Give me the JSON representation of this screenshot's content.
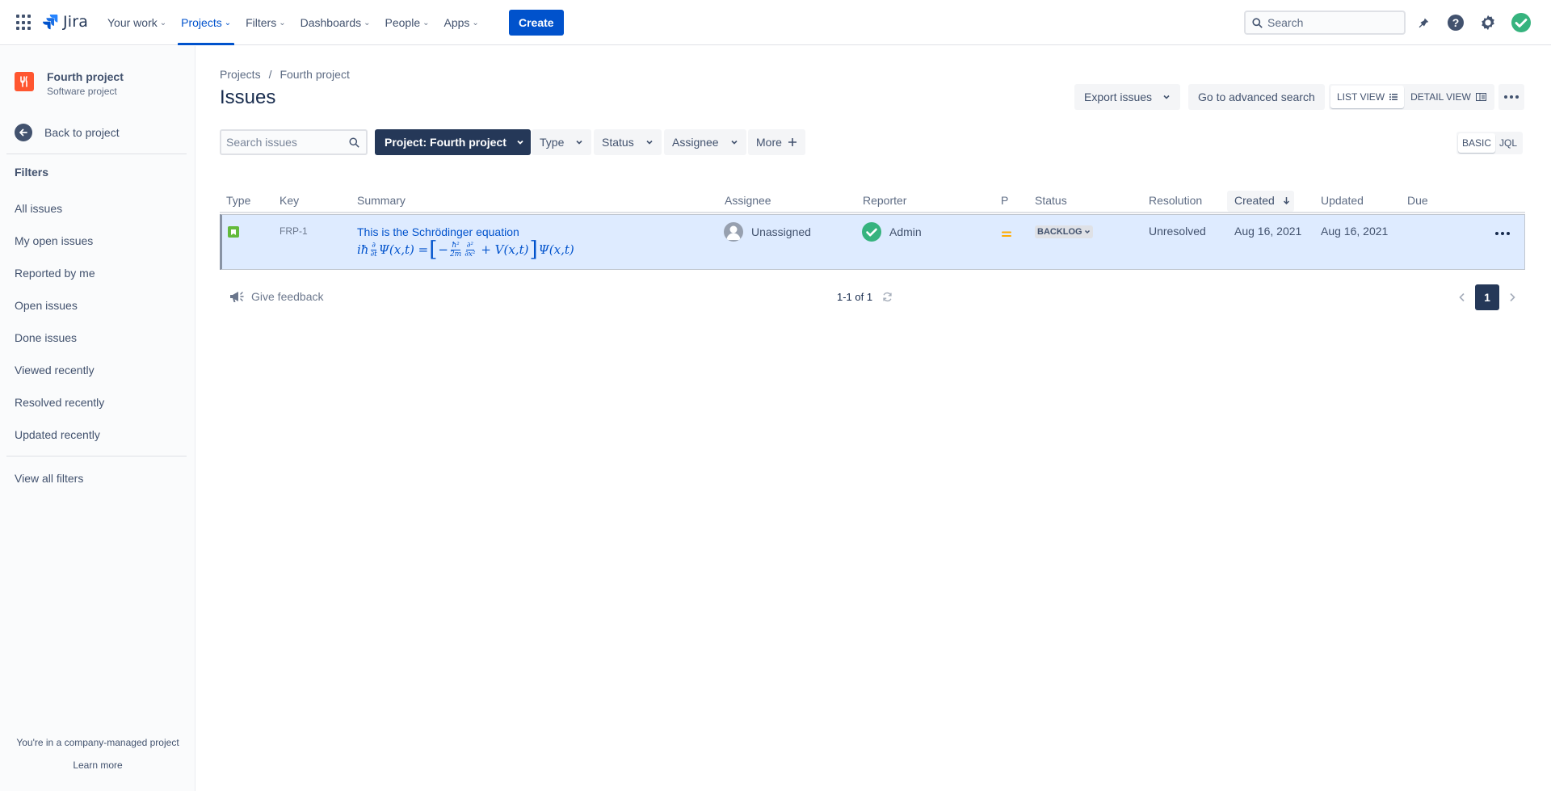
{
  "topnav": {
    "logo_text": "Jira",
    "items": [
      {
        "label": "Your work",
        "active": false
      },
      {
        "label": "Projects",
        "active": true
      },
      {
        "label": "Filters",
        "active": false
      },
      {
        "label": "Dashboards",
        "active": false
      },
      {
        "label": "People",
        "active": false
      },
      {
        "label": "Apps",
        "active": false
      }
    ],
    "create_label": "Create",
    "search_placeholder": "Search"
  },
  "sidebar": {
    "project_name": "Fourth project",
    "project_type": "Software project",
    "back_label": "Back to project",
    "filters_title": "Filters",
    "filters": [
      "All issues",
      "My open issues",
      "Reported by me",
      "Open issues",
      "Done issues",
      "Viewed recently",
      "Resolved recently",
      "Updated recently"
    ],
    "view_all": "View all filters",
    "footer_note": "You're in a company-managed project",
    "learn_more": "Learn more"
  },
  "main": {
    "breadcrumb": [
      "Projects",
      "/",
      "Fourth project"
    ],
    "title": "Issues",
    "export_label": "Export issues",
    "advanced_search_label": "Go to advanced search",
    "list_view_label": "LIST VIEW",
    "detail_view_label": "DETAIL VIEW",
    "search_placeholder": "Search issues",
    "project_filter_label": "Project: Fourth project",
    "filter_buttons": [
      "Type",
      "Status",
      "Assignee",
      "More"
    ],
    "basic_label": "BASIC",
    "jql_label": "JQL"
  },
  "table": {
    "columns": [
      "Type",
      "Key",
      "Summary",
      "Assignee",
      "Reporter",
      "P",
      "Status",
      "Resolution",
      "Created",
      "Updated",
      "Due"
    ],
    "rows": [
      {
        "key": "FRP-1",
        "summary": "This is the Schrödinger equation",
        "assignee": "Unassigned",
        "reporter": "Admin",
        "status": "BACKLOG",
        "resolution": "Unresolved",
        "created": "Aug 16, 2021",
        "updated": "Aug 16, 2021",
        "due": ""
      }
    ]
  },
  "footer": {
    "feedback_label": "Give feedback",
    "pagination_info": "1-1 of 1",
    "current_page": "1"
  },
  "colors": {
    "brand": "#0052cc",
    "nav_dark": "#253858",
    "row_selected": "#deebff",
    "project_avatar": "#ff5630",
    "success": "#36b37e",
    "priority_medium": "#ffab00"
  }
}
